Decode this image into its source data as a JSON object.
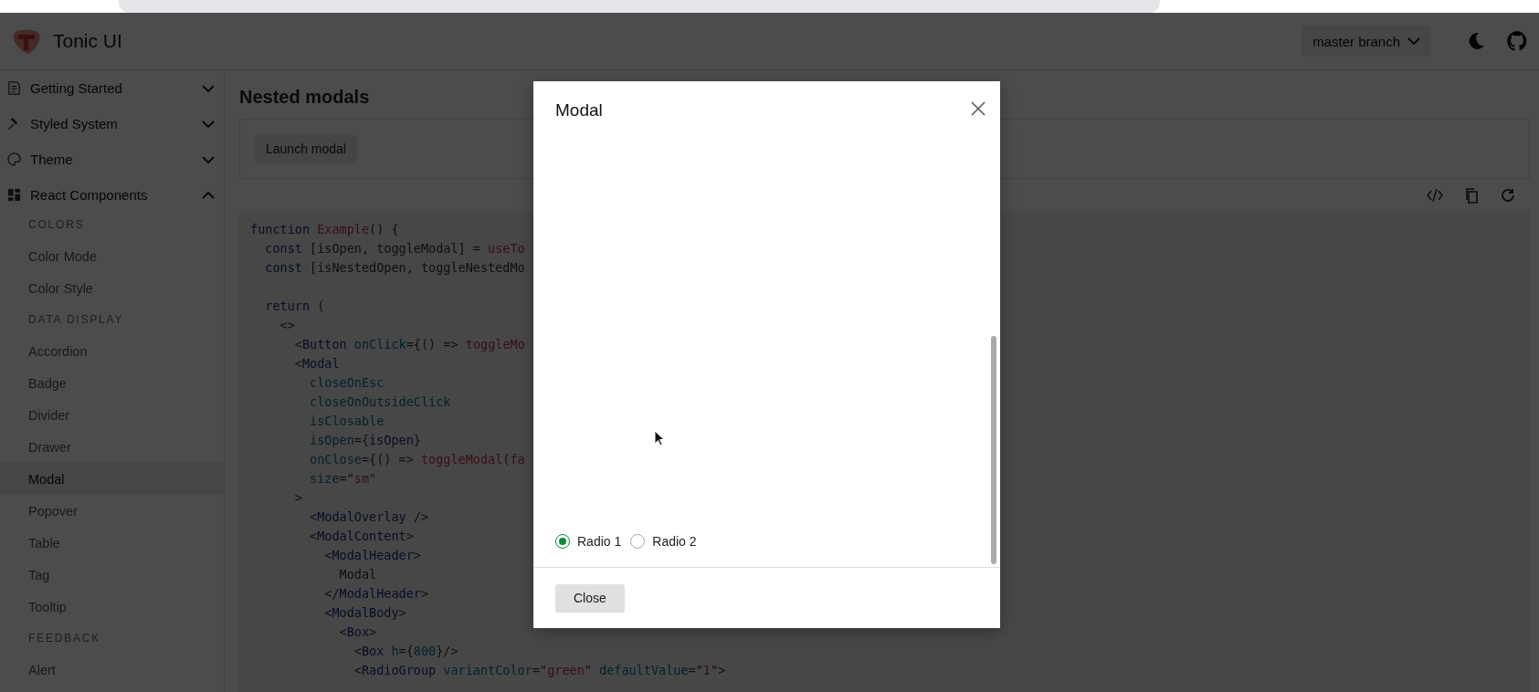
{
  "header": {
    "brand": "Tonic UI",
    "branch_menu": "master branch"
  },
  "sidebar": {
    "items": [
      {
        "label": "Getting Started",
        "expanded": false
      },
      {
        "label": "Styled System",
        "expanded": false
      },
      {
        "label": "Theme",
        "expanded": false
      },
      {
        "label": "React Components",
        "expanded": true,
        "children": [
          {
            "heading": "COLORS",
            "children": [
              {
                "label": "Color Mode",
                "selected": false
              },
              {
                "label": "Color Style",
                "selected": false
              }
            ]
          },
          {
            "heading": "DATA DISPLAY",
            "children": [
              {
                "label": "Accordion",
                "selected": false
              },
              {
                "label": "Badge",
                "selected": false
              },
              {
                "label": "Divider",
                "selected": false
              },
              {
                "label": "Drawer",
                "selected": false
              },
              {
                "label": "Modal",
                "selected": true
              },
              {
                "label": "Popover",
                "selected": false
              },
              {
                "label": "Table",
                "selected": false
              },
              {
                "label": "Tag",
                "selected": false
              },
              {
                "label": "Tooltip",
                "selected": false
              }
            ]
          },
          {
            "heading": "FEEDBACK",
            "children": [
              {
                "label": "Alert",
                "selected": false
              }
            ]
          }
        ]
      }
    ]
  },
  "page": {
    "title": "Nested modals",
    "launch_button": "Launch modal"
  },
  "code": {
    "blocks": [
      [
        [
          {
            "kind": "keyword",
            "text": "function"
          },
          {
            "kind": "func",
            "text": " Example"
          },
          {
            "kind": "plain",
            "text": "() {"
          }
        ],
        [
          {
            "kind": "keyword",
            "text": "  const"
          },
          {
            "kind": "plain",
            "text": " [isOpen, toggleModal] = "
          },
          {
            "kind": "func",
            "text": "useTo"
          }
        ],
        [
          {
            "kind": "keyword",
            "text": "  const"
          },
          {
            "kind": "plain",
            "text": " [isNestedOpen, toggleNestedMo"
          }
        ]
      ],
      [
        [
          {
            "kind": "keyword",
            "text": "  return"
          },
          {
            "kind": "plain",
            "text": " ("
          }
        ],
        [
          {
            "kind": "plain",
            "text": "    <>"
          }
        ],
        [
          {
            "kind": "plain",
            "text": "      <"
          },
          {
            "kind": "tag",
            "text": "Button"
          },
          {
            "kind": "attr",
            "text": " onClick"
          },
          {
            "kind": "plain",
            "text": "={() => "
          },
          {
            "kind": "func",
            "text": "toggleMo"
          }
        ],
        [
          {
            "kind": "plain",
            "text": "      <"
          },
          {
            "kind": "tag",
            "text": "Modal"
          }
        ],
        [
          {
            "kind": "attr",
            "text": "        closeOnEsc"
          }
        ],
        [
          {
            "kind": "attr",
            "text": "        closeOnOutsideClick"
          }
        ],
        [
          {
            "kind": "attr",
            "text": "        isClosable"
          }
        ],
        [
          {
            "kind": "attr",
            "text": "        isOpen"
          },
          {
            "kind": "plain",
            "text": "={"
          },
          {
            "kind": "tag",
            "text": "isOpen"
          },
          {
            "kind": "plain",
            "text": "}"
          }
        ],
        [
          {
            "kind": "attr",
            "text": "        onClose"
          },
          {
            "kind": "plain",
            "text": "={() => "
          },
          {
            "kind": "func",
            "text": "toggleModal"
          },
          {
            "kind": "plain",
            "text": "("
          },
          {
            "kind": "func",
            "text": "fa"
          }
        ],
        [
          {
            "kind": "attr",
            "text": "        size"
          },
          {
            "kind": "plain",
            "text": "=\""
          },
          {
            "kind": "string",
            "text": "sm"
          },
          {
            "kind": "plain",
            "text": "\""
          }
        ],
        [
          {
            "kind": "plain",
            "text": "      >"
          }
        ],
        [
          {
            "kind": "plain",
            "text": "        <"
          },
          {
            "kind": "tag",
            "text": "ModalOverlay"
          },
          {
            "kind": "plain",
            "text": " />"
          }
        ],
        [
          {
            "kind": "plain",
            "text": "        <"
          },
          {
            "kind": "tag",
            "text": "ModalContent"
          },
          {
            "kind": "plain",
            "text": ">"
          }
        ],
        [
          {
            "kind": "plain",
            "text": "          <"
          },
          {
            "kind": "tag",
            "text": "ModalHeader"
          },
          {
            "kind": "plain",
            "text": ">"
          }
        ],
        [
          {
            "kind": "plain",
            "text": "            Modal"
          }
        ],
        [
          {
            "kind": "plain",
            "text": "          </"
          },
          {
            "kind": "tag",
            "text": "ModalHeader"
          },
          {
            "kind": "plain",
            "text": ">"
          }
        ],
        [
          {
            "kind": "plain",
            "text": "          <"
          },
          {
            "kind": "tag",
            "text": "ModalBody"
          },
          {
            "kind": "plain",
            "text": ">"
          }
        ],
        [
          {
            "kind": "plain",
            "text": "            <"
          },
          {
            "kind": "tag",
            "text": "Box"
          },
          {
            "kind": "plain",
            "text": ">"
          }
        ],
        [
          {
            "kind": "plain",
            "text": "              <"
          },
          {
            "kind": "tag",
            "text": "Box"
          },
          {
            "kind": "attr",
            "text": " h"
          },
          {
            "kind": "plain",
            "text": "={"
          },
          {
            "kind": "number",
            "text": "800"
          },
          {
            "kind": "plain",
            "text": "}/>"
          }
        ],
        [
          {
            "kind": "plain",
            "text": "              <"
          },
          {
            "kind": "tag",
            "text": "RadioGroup"
          },
          {
            "kind": "attr",
            "text": " variantColor"
          },
          {
            "kind": "plain",
            "text": "=\""
          },
          {
            "kind": "string",
            "text": "green"
          },
          {
            "kind": "plain",
            "text": "\""
          },
          {
            "kind": "attr",
            "text": " defaultValue"
          },
          {
            "kind": "plain",
            "text": "=\""
          },
          {
            "kind": "string",
            "text": "1"
          },
          {
            "kind": "plain",
            "text": "\">"
          }
        ]
      ]
    ]
  },
  "modal": {
    "title": "Modal",
    "radios": [
      {
        "label": "Radio 1",
        "selected": true
      },
      {
        "label": "Radio 2",
        "selected": false
      }
    ],
    "close_button": "Close"
  }
}
